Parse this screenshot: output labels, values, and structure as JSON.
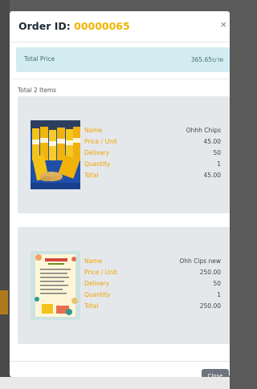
{
  "modal": {
    "title_prefix": "Order ID:",
    "order_id": "00000065",
    "close_icon": "×",
    "total_price_label": "Total Price",
    "total_price_value": "365.65บาท",
    "items_count_text": "Total 2 Items",
    "close_button_label": "Close"
  },
  "labels": {
    "name": "Name",
    "price_unit": "Price / Unit",
    "delivery": "Delivery",
    "quantity": "Quantity",
    "total": "Total"
  },
  "items": [
    {
      "name": "Ohhh Chips",
      "price_unit": "45.00",
      "delivery": "50",
      "quantity": "1",
      "total": "45.00",
      "image": "chips-bags-photo"
    },
    {
      "name": "Ohh Cips new",
      "price_unit": "250.00",
      "delivery": "50",
      "quantity": "1",
      "total": "250.00",
      "image": "product-poster"
    }
  ],
  "colors": {
    "accent": "#f0b400",
    "label": "#f0a500",
    "price_box": "#d3ecf2",
    "card": "#e5e8eb",
    "close_button": "#6c757d"
  }
}
